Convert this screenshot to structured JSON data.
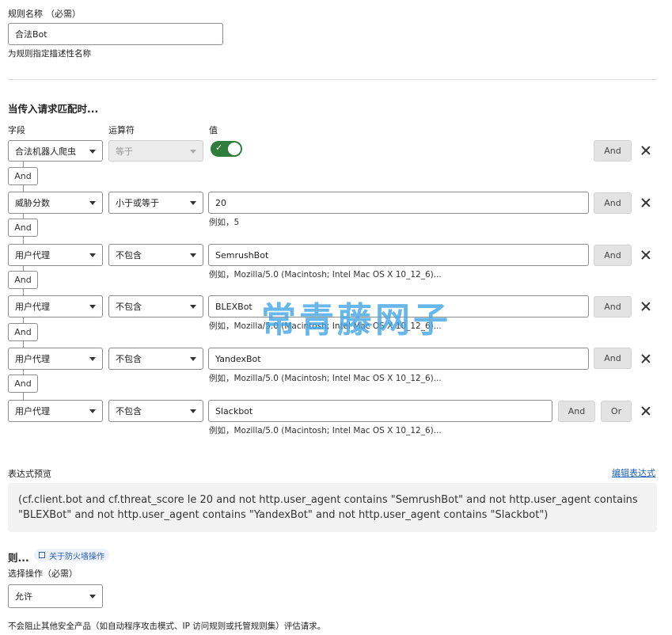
{
  "rule_name": {
    "label": "规则名称",
    "required": "（必需）",
    "value": "合法Bot",
    "help": "为规则指定描述性名称"
  },
  "match": {
    "heading": "当传入请求匹配时...",
    "col_field": "字段",
    "col_operator": "运算符",
    "col_value": "值",
    "and_badge": "And",
    "rows": [
      {
        "field": "合法机器人爬虫",
        "operator": "等于",
        "value_toggle": true,
        "and": "And"
      },
      {
        "field": "威胁分数",
        "operator": "小于或等于",
        "value": "20",
        "hint": "例如，5",
        "and": "And"
      },
      {
        "field": "用户代理",
        "operator": "不包含",
        "value": "SemrushBot",
        "hint": "例如，Mozilla/5.0 (Macintosh; Intel Mac OS X 10_12_6)...",
        "and": "And"
      },
      {
        "field": "用户代理",
        "operator": "不包含",
        "value": "BLEXBot",
        "hint": "例如，Mozilla/5.0 (Macintosh; Intel Mac OS X 10_12_6)...",
        "and": "And"
      },
      {
        "field": "用户代理",
        "operator": "不包含",
        "value": "YandexBot",
        "hint": "例如，Mozilla/5.0 (Macintosh; Intel Mac OS X 10_12_6)...",
        "and": "And"
      },
      {
        "field": "用户代理",
        "operator": "不包含",
        "value": "Slackbot",
        "hint": "例如，Mozilla/5.0 (Macintosh; Intel Mac OS X 10_12_6)...",
        "and": "And",
        "or": "Or"
      }
    ]
  },
  "expression": {
    "label": "表达式预览",
    "edit_link": "编辑表达式",
    "text": "(cf.client.bot and cf.threat_score le 20 and not http.user_agent contains \"SemrushBot\" and not http.user_agent contains \"BLEXBot\" and not http.user_agent contains \"YandexBot\" and not http.user_agent contains \"Slackbot\")"
  },
  "then": {
    "heading": "则...",
    "firewall_tag": "关于防火墙操作",
    "action_label": "选择操作（必需）",
    "action_value": "允许",
    "note": "不会阻止其他安全产品（如自动程序攻击模式、IP 访问规则或托管规则集）评估请求。"
  },
  "watermark": "常青藤网子",
  "colors": {
    "toggle_on": "#2f7d3d",
    "link": "#1c5fb5",
    "watermark": "#42a5e6"
  }
}
